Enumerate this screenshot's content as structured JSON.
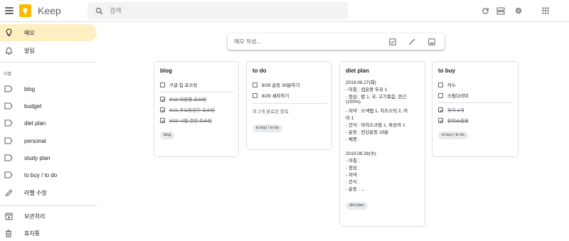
{
  "header": {
    "app_title": "Keep",
    "search_placeholder": "검색"
  },
  "sidebar": {
    "memo_label": "메모",
    "reminder_label": "알림",
    "labels_section": "라벨",
    "labels": [
      "blog",
      "budget",
      "diet plan",
      "personal",
      "study plan",
      "to buy / to do"
    ],
    "edit_labels": "라벨 수정",
    "archive_label": "보관처리",
    "trash_label": "휴지통"
  },
  "take_note": {
    "placeholder": "메모 작성..."
  },
  "notes": {
    "blog": {
      "title": "blog",
      "items": [
        {
          "text": "구글 킵 포스팅",
          "checked": false
        },
        {
          "text": "8/19 파장풍 포스팅",
          "checked": true
        },
        {
          "text": "8/21 퓨오동점무 포스팅",
          "checked": true
        },
        {
          "text": "8/23 시험 관련 포스팅",
          "checked": true
        }
      ],
      "label": "blog"
    },
    "todo": {
      "title": "to do",
      "items": [
        {
          "text": "8/29 운동 30분하기",
          "checked": false
        },
        {
          "text": "8/29 세차하기",
          "checked": false
        }
      ],
      "done_count": "외 2개 완료된 항목",
      "label": "to buy / to do"
    },
    "diet": {
      "title": "diet plan",
      "lines": [
        "2019.08.27(화)",
        "- 아침 : 검은콩 두유 1",
        "- 점심 : 밥 1, 국, 고기볶음, 연근",
        "(100%)",
        "- 저녁 : 스낵랩 1, 치즈스틱 2, 아",
        "아 1",
        "- 간식 : 아이스크림 1, 록승아 1",
        "- 운동 : 전신운동 10분",
        "- 체중 :",
        "",
        "2019.08.28(수)",
        "- 아침 :",
        "- 점심 :",
        "- 저녁 :",
        "- 간식 :",
        "- 운동 : ..."
      ],
      "label": "diet plan"
    },
    "tobuy": {
      "title": "to buy",
      "items": [
        {
          "text": "카누",
          "checked": false
        },
        {
          "text": "스팀다리미",
          "checked": false
        },
        {
          "text": "휴지 1개",
          "checked": true
        },
        {
          "text": "원피스잠옷",
          "checked": true
        }
      ],
      "label": "to buy / to do"
    }
  },
  "colors": {
    "accent": "#fbbc04",
    "active_nav": "#feefc3",
    "chip": "#e8eaed"
  }
}
